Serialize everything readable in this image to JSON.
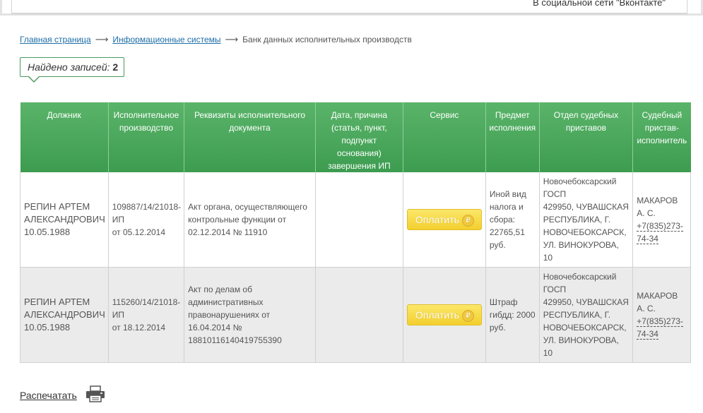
{
  "top_banner": {
    "social_text": "В социальной сети \"Вконтакте\""
  },
  "breadcrumb": {
    "home": "Главная страница",
    "info_systems": "Информационные системы",
    "current": "Банк данных исполнительных производств",
    "separator": "⟶"
  },
  "found": {
    "label": "Найдено записей:",
    "count": "2"
  },
  "table": {
    "headers": [
      "Должник",
      "Исполнительное производство",
      "Реквизиты исполнительного документа",
      "Дата, причина (статья, пункт, подпункт основания) завершения ИП",
      "Сервис",
      "Предмет исполнения",
      "Отдел судебных приставов",
      "Судебный пристав-исполнитель"
    ],
    "rows": [
      {
        "debtor_name": "РЕПИН АРТЕМ АЛЕКСАНДРОВИЧ",
        "debtor_dob": "10.05.1988",
        "proceeding_number": "109887/14/21018-ИП",
        "proceeding_date": "от 05.12.2014",
        "document": "Акт органа, осуществляющего контрольные функции от 02.12.2014 № 11910",
        "completion": "",
        "pay_label": "Оплатить",
        "subject": "Иной вид налога и сбора: 22765,51 руб.",
        "department": "Новочебоксарский ГОСП",
        "department_address": "429950, ЧУВАШСКАЯ РЕСПУБЛИКА, Г. НОВОЧЕБОКСАРСК, УЛ. ВИНОКУРОВА, 10",
        "bailiff_name": "МАКАРОВ А. С.",
        "bailiff_phone": "+7(835)273-74-34"
      },
      {
        "debtor_name": "РЕПИН АРТЕМ АЛЕКСАНДРОВИЧ",
        "debtor_dob": "10.05.1988",
        "proceeding_number": "115260/14/21018-ИП",
        "proceeding_date": "от 18.12.2014",
        "document": "Акт по делам об административных правонарушениях от 16.04.2014 № 18810116140419755390",
        "completion": "",
        "pay_label": "Оплатить",
        "subject": "Штраф гибдд: 2000 руб.",
        "department": "Новочебоксарский ГОСП",
        "department_address": "429950, ЧУВАШСКАЯ РЕСПУБЛИКА, Г. НОВОЧЕБОКСАРСК, УЛ. ВИНОКУРОВА, 10",
        "bailiff_name": "МАКАРОВ А. С.",
        "bailiff_phone": "+7(835)273-74-34"
      }
    ]
  },
  "print": {
    "label": "Распечатать"
  },
  "icons": {
    "pay": "ruble-icon",
    "print": "printer-icon"
  },
  "colors": {
    "header_green": "#45a357",
    "pay_yellow": "#f7dc4a",
    "link_blue": "#1e6ea7"
  }
}
